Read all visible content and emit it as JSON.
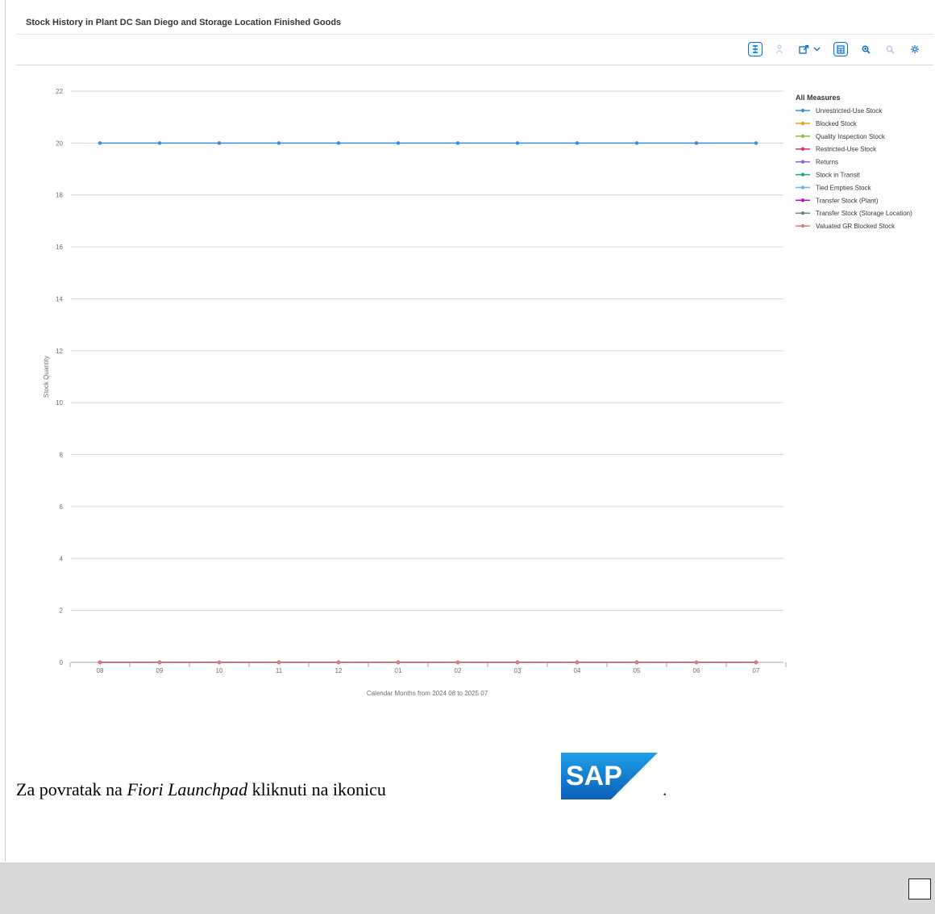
{
  "chart_title": "Stock History in Plant DC San Diego and Storage Location Finished Goods",
  "toolbar": {
    "icons": [
      "legend-toggle-icon",
      "person-icon",
      "share-icon",
      "dropdown-icon",
      "table-view-icon",
      "zoom-in-icon",
      "zoom-out-icon",
      "settings-icon"
    ]
  },
  "chart_data": {
    "type": "line",
    "title": "",
    "xlabel": "Calendar Months from 2024 08 to 2025 07",
    "ylabel": "Stock Quantity",
    "ylim": [
      0,
      22
    ],
    "yticks": [
      "0",
      "2",
      "4",
      "6",
      "8",
      "10",
      "12",
      "14",
      "16",
      "18",
      "20",
      "22"
    ],
    "categories": [
      "08",
      "09",
      "10",
      "11",
      "12",
      "01",
      "02",
      "03",
      "04",
      "05",
      "06",
      "07"
    ],
    "legend_title": "All Measures",
    "legend_position": "right",
    "grid": true,
    "series": [
      {
        "name": "Unrestricted-Use Stock",
        "color": "#3b8fe0",
        "values": [
          20,
          20,
          20,
          20,
          20,
          20,
          20,
          20,
          20,
          20,
          20,
          20
        ]
      },
      {
        "name": "Blocked Stock",
        "color": "#e3a21a",
        "values": [
          0,
          0,
          0,
          0,
          0,
          0,
          0,
          0,
          0,
          0,
          0,
          0
        ]
      },
      {
        "name": "Quality Inspection Stock",
        "color": "#8fbf3f",
        "values": [
          0,
          0,
          0,
          0,
          0,
          0,
          0,
          0,
          0,
          0,
          0,
          0
        ]
      },
      {
        "name": "Restricted-Use Stock",
        "color": "#d6325a",
        "values": [
          0,
          0,
          0,
          0,
          0,
          0,
          0,
          0,
          0,
          0,
          0,
          0
        ]
      },
      {
        "name": "Returns",
        "color": "#8d5ad9",
        "values": [
          0,
          0,
          0,
          0,
          0,
          0,
          0,
          0,
          0,
          0,
          0,
          0
        ]
      },
      {
        "name": "Stock in Transit",
        "color": "#21a38a",
        "values": [
          0,
          0,
          0,
          0,
          0,
          0,
          0,
          0,
          0,
          0,
          0,
          0
        ]
      },
      {
        "name": "Tied Empties Stock",
        "color": "#6cb4f0",
        "values": [
          0,
          0,
          0,
          0,
          0,
          0,
          0,
          0,
          0,
          0,
          0,
          0
        ]
      },
      {
        "name": "Transfer Stock (Plant)",
        "color": "#b40fc7",
        "values": [
          0,
          0,
          0,
          0,
          0,
          0,
          0,
          0,
          0,
          0,
          0,
          0
        ]
      },
      {
        "name": "Transfer Stock (Storage Location)",
        "color": "#6a8a73",
        "values": [
          0,
          0,
          0,
          0,
          0,
          0,
          0,
          0,
          0,
          0,
          0,
          0
        ]
      },
      {
        "name": "Valuated GR Blocked Stock",
        "color": "#e07a7a",
        "values": [
          0,
          0,
          0,
          0,
          0,
          0,
          0,
          0,
          0,
          0,
          0,
          0
        ]
      }
    ]
  },
  "footer": {
    "text_before": "Za povratak na ",
    "text_italic": "Fiori Launchpad",
    "text_after": " kliknuti na ikonicu",
    "trailing": ".",
    "logo_text": "SAP",
    "logo_color": "#1a73c8"
  }
}
